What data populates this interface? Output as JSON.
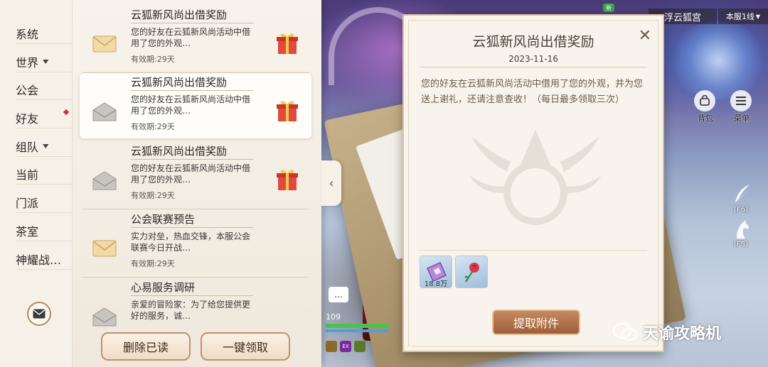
{
  "hud": {
    "location": "浮云狐宫",
    "server": "本服1线",
    "new_badge": "新",
    "bag_label": "背包",
    "menu_label": "菜单",
    "skill_f6": "[F6]",
    "skill_f5": "[F5]",
    "level": "109",
    "chat_icon": "…",
    "hp_fraction": 1.0,
    "mp_fraction": 1.0,
    "buff_ex": "EX"
  },
  "nav": {
    "items": [
      {
        "label": "系统"
      },
      {
        "label": "世界"
      },
      {
        "label": "公会"
      },
      {
        "label": "好友"
      },
      {
        "label": "组队"
      },
      {
        "label": "当前"
      },
      {
        "label": "门派"
      },
      {
        "label": "茶室"
      },
      {
        "label": "神耀战…"
      }
    ],
    "chevron": "▼"
  },
  "mails": [
    {
      "title": "云狐新风尚出借奖励",
      "body": "您的好友在云狐新风尚活动中借用了您的外观…",
      "expire": "有效期:29天"
    },
    {
      "title": "云狐新风尚出借奖励",
      "body": "您的好友在云狐新风尚活动中借用了您的外观…",
      "expire": "有效期:29天"
    },
    {
      "title": "云狐新风尚出借奖励",
      "body": "您的好友在云狐新风尚活动中借用了您的外观…",
      "expire": "有效期:29天"
    },
    {
      "title": "公会联赛预告",
      "body": "实力对垒，热血交锋，本服公会联赛今日开战…",
      "expire": "有效期:29天"
    },
    {
      "title": "心易服务调研",
      "body": "亲爱的冒险家：为了给您提供更好的服务，诚…",
      "expire": ""
    }
  ],
  "buttons": {
    "delete_read": "删除已读",
    "claim_all": "一键领取",
    "collapse": "‹",
    "claim_attachment": "提取附件",
    "close": "✕"
  },
  "letter": {
    "title": "云狐新风尚出借奖励",
    "date": "2023-11-16",
    "body": "您的好友在云狐新风尚活动中借用了您的外观，并为您送上谢礼，还请注意查收！（每日最多领取三次）",
    "attachments": [
      {
        "icon": "ticket-icon",
        "count": "18.8万"
      },
      {
        "icon": "rose-icon",
        "count": ""
      }
    ]
  },
  "watermark": "天谕攻略机",
  "colors": {
    "panel_bg": "#f7f3ec",
    "accent": "#9d5f3a",
    "gift_red": "#d9423a"
  }
}
